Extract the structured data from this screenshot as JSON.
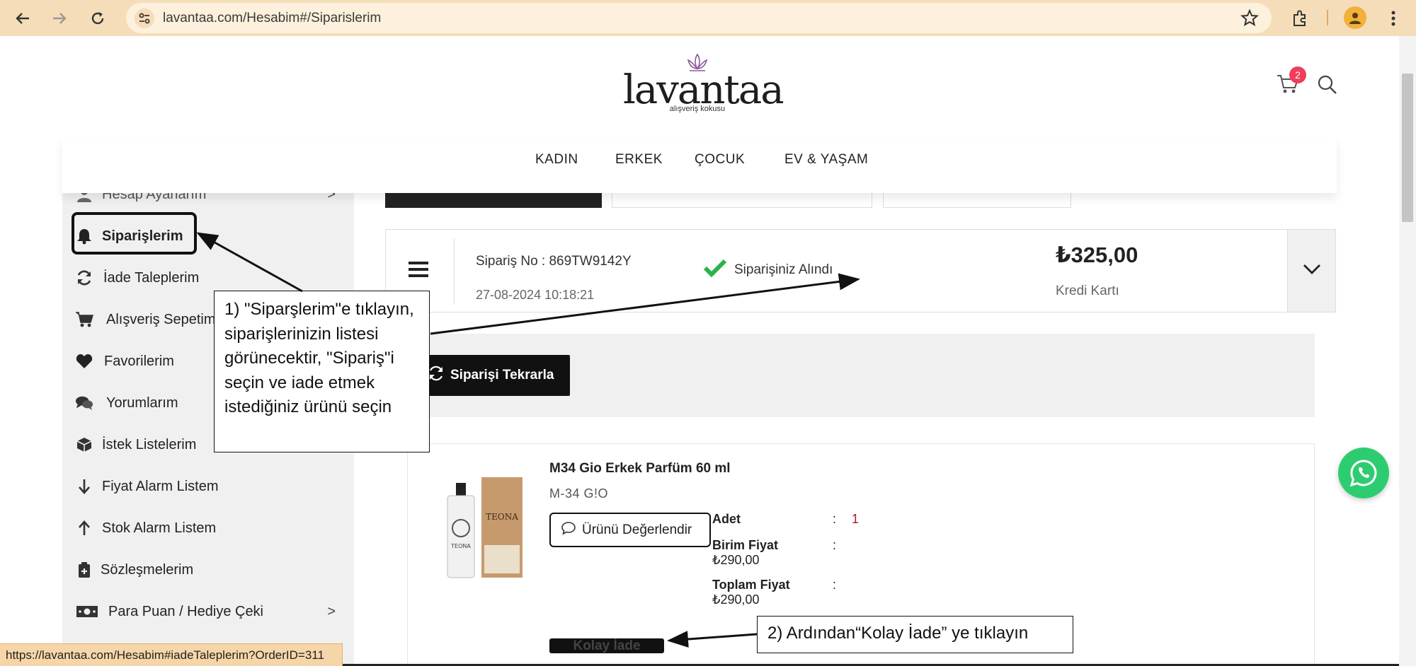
{
  "browser": {
    "url": "lavantaa.com/Hesabim#/Siparislerim",
    "status_url": "https://lavantaa.com/Hesabim#iadeTaleplerim?OrderID=311"
  },
  "header": {
    "logo_text": "lavantaa",
    "logo_tagline": "alışveriş kokusu",
    "cart_count": "2"
  },
  "nav": {
    "items": [
      "KADIN",
      "ERKEK",
      "ÇOCUK",
      "EV & YAŞAM"
    ]
  },
  "sidebar": {
    "items": [
      {
        "label": "Hesap Ayarlarım",
        "icon": "user-icon",
        "chevron": ">"
      },
      {
        "label": "Siparişlerim",
        "icon": "bell-icon",
        "chevron": ""
      },
      {
        "label": "İade Taleplerim",
        "icon": "refresh-icon",
        "chevron": ""
      },
      {
        "label": "Alışveriş Sepetim",
        "icon": "cart-icon",
        "chevron": ""
      },
      {
        "label": "Favorilerim",
        "icon": "heart-icon",
        "chevron": ""
      },
      {
        "label": "Yorumlarım",
        "icon": "comments-icon",
        "chevron": ""
      },
      {
        "label": "İstek Listelerim",
        "icon": "box-icon",
        "chevron": ""
      },
      {
        "label": "Fiyat Alarm Listem",
        "icon": "arrow-down-icon",
        "chevron": ""
      },
      {
        "label": "Stok Alarm Listem",
        "icon": "arrow-up-icon",
        "chevron": ""
      },
      {
        "label": "Sözleşmelerim",
        "icon": "clipboard-icon",
        "chevron": ""
      },
      {
        "label": "Para Puan / Hediye Çeki",
        "icon": "money-icon",
        "chevron": ">"
      }
    ]
  },
  "order": {
    "number": "Sipariş No : 869TW9142Y",
    "date": "27-08-2024 10:18:21",
    "status": "Siparişiniz Alındı",
    "total": "₺325,00",
    "payment": "Kredi Kartı",
    "reorder_label": "Siparişi Tekrarla"
  },
  "product": {
    "title": "M34 Gio Erkek Parfüm 60 ml",
    "brand": "M-34 G!O",
    "review_label": "Ürünü Değerlendir",
    "qty_label": "Adet",
    "qty_value": "1",
    "unit_price_label": "Birim Fiyat",
    "unit_price_value": "₺290,00",
    "total_price_label": "Toplam Fiyat",
    "total_price_value": "₺290,00",
    "colon": ":",
    "easy_return_label": "Kolay İade"
  },
  "annotations": {
    "note1": "1) \"Siparşlerim\"e tıklayın, siparişlerinizin listesi görünecektir, \"Sipariş\"i seçin ve iade etmek istediğiniz ürünü seçin",
    "note2": "2) Ardından“Kolay İade” ye tıklayın"
  }
}
